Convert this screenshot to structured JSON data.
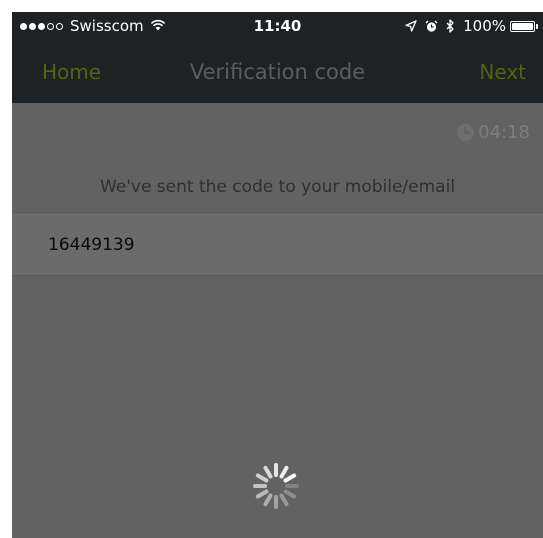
{
  "status_bar": {
    "carrier": "Swisscom",
    "time": "11:40",
    "battery": "100%",
    "signal_dots": [
      "full",
      "full",
      "full",
      "empty",
      "empty"
    ],
    "icons": [
      "wifi-icon",
      "location-arrow-icon",
      "alarm-icon",
      "bluetooth-icon",
      "battery-icon"
    ]
  },
  "nav": {
    "back_label": "Home",
    "title": "Verification code",
    "next_label": "Next"
  },
  "timer": {
    "value": "04:18",
    "icon": "clock-icon"
  },
  "message": "We've sent the code to your mobile/email",
  "code_field": {
    "value": "16449139"
  },
  "colors": {
    "nav_background": "#1e2224",
    "nav_action": "#4f6612",
    "overlay": "#626262",
    "text_dark": "#2f2f2f"
  },
  "spinner": {
    "icon": "loading-spinner-icon"
  }
}
